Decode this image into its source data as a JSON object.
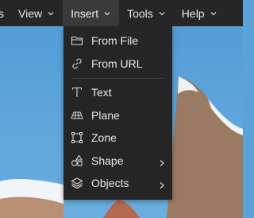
{
  "menubar": {
    "items": [
      {
        "label": "s",
        "has_chevron": false
      },
      {
        "label": "View",
        "has_chevron": true
      },
      {
        "label": "Insert",
        "has_chevron": true,
        "active": true
      },
      {
        "label": "Tools",
        "has_chevron": true
      },
      {
        "label": "Help",
        "has_chevron": true
      }
    ]
  },
  "insert_menu": {
    "groups": [
      [
        {
          "label": "From File",
          "icon": "folder-icon"
        },
        {
          "label": "From URL",
          "icon": "link-icon"
        }
      ],
      [
        {
          "label": "Text",
          "icon": "text-icon"
        },
        {
          "label": "Plane",
          "icon": "plane-grid-icon"
        },
        {
          "label": "Zone",
          "icon": "zone-icon"
        },
        {
          "label": "Shape",
          "icon": "shapes-icon",
          "submenu": true
        },
        {
          "label": "Objects",
          "icon": "objects-stack-icon",
          "submenu": true
        }
      ]
    ]
  },
  "colors": {
    "menubar_bg": "#262626",
    "menu_bg": "#252525",
    "active_menu_bg": "#3a3a3a",
    "text": "#e8e8e8",
    "sky": "#5aa2d8"
  }
}
